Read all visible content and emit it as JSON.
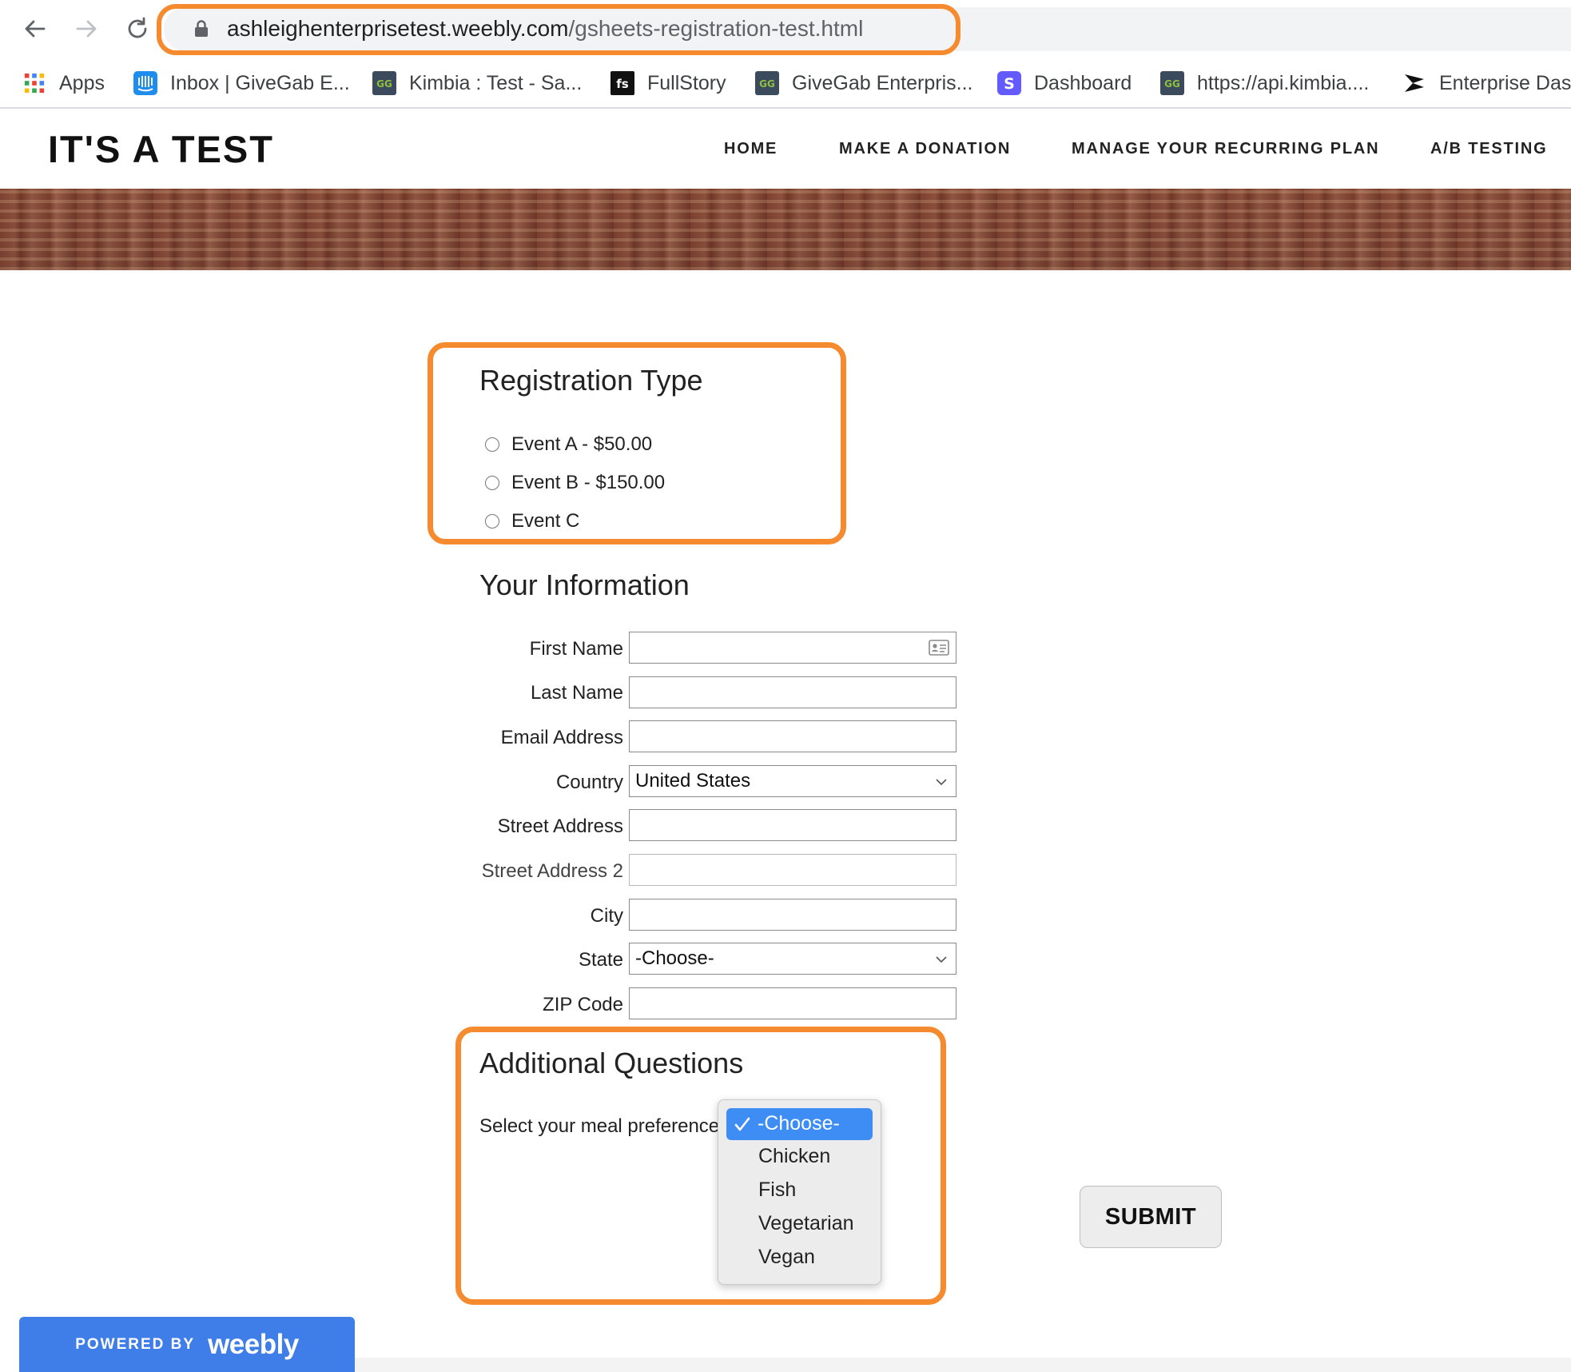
{
  "browser": {
    "url_host": "ashleighenterprisetest.weebly.com",
    "url_path": "/gsheets-registration-test.html",
    "highlight_color": "#f58a2e",
    "bookmarks": [
      {
        "label": "Apps",
        "icon": "apps-grid-icon"
      },
      {
        "label": "Inbox | GiveGab E...",
        "icon": "intercom-icon"
      },
      {
        "label": "Kimbia : Test - Sa...",
        "icon": "givegab-icon"
      },
      {
        "label": "FullStory",
        "icon": "fullstory-icon"
      },
      {
        "label": "GiveGab Enterpris...",
        "icon": "givegab-icon"
      },
      {
        "label": "Dashboard",
        "icon": "stripe-icon"
      },
      {
        "label": "https://api.kimbia....",
        "icon": "givegab-icon"
      },
      {
        "label": "Enterprise Das",
        "icon": "enterprise-icon"
      }
    ]
  },
  "site": {
    "logo": "IT'S A TEST",
    "nav": [
      "HOME",
      "MAKE A DONATION",
      "MANAGE YOUR RECURRING PLAN",
      "A/B TESTING"
    ]
  },
  "registration": {
    "title": "Registration Type",
    "options": [
      "Event A - $50.00",
      "Event B - $150.00",
      "Event C"
    ]
  },
  "info": {
    "title": "Your Information",
    "fields": {
      "first_name": "First Name",
      "last_name": "Last Name",
      "email": "Email Address",
      "country": "Country",
      "street": "Street Address",
      "street2": "Street Address 2",
      "city": "City",
      "state": "State",
      "zip": "ZIP Code"
    },
    "country_value": "United States",
    "state_value": "-Choose-"
  },
  "questions": {
    "title": "Additional Questions",
    "meal_label": "Select your meal preference",
    "meal_options": [
      "-Choose-",
      "Chicken",
      "Fish",
      "Vegetarian",
      "Vegan"
    ],
    "meal_selected": "-Choose-"
  },
  "submit_label": "SUBMIT",
  "footer": {
    "powered_by": "POWERED BY",
    "brand": "weebly",
    "brand_color": "#3f7ee8"
  }
}
